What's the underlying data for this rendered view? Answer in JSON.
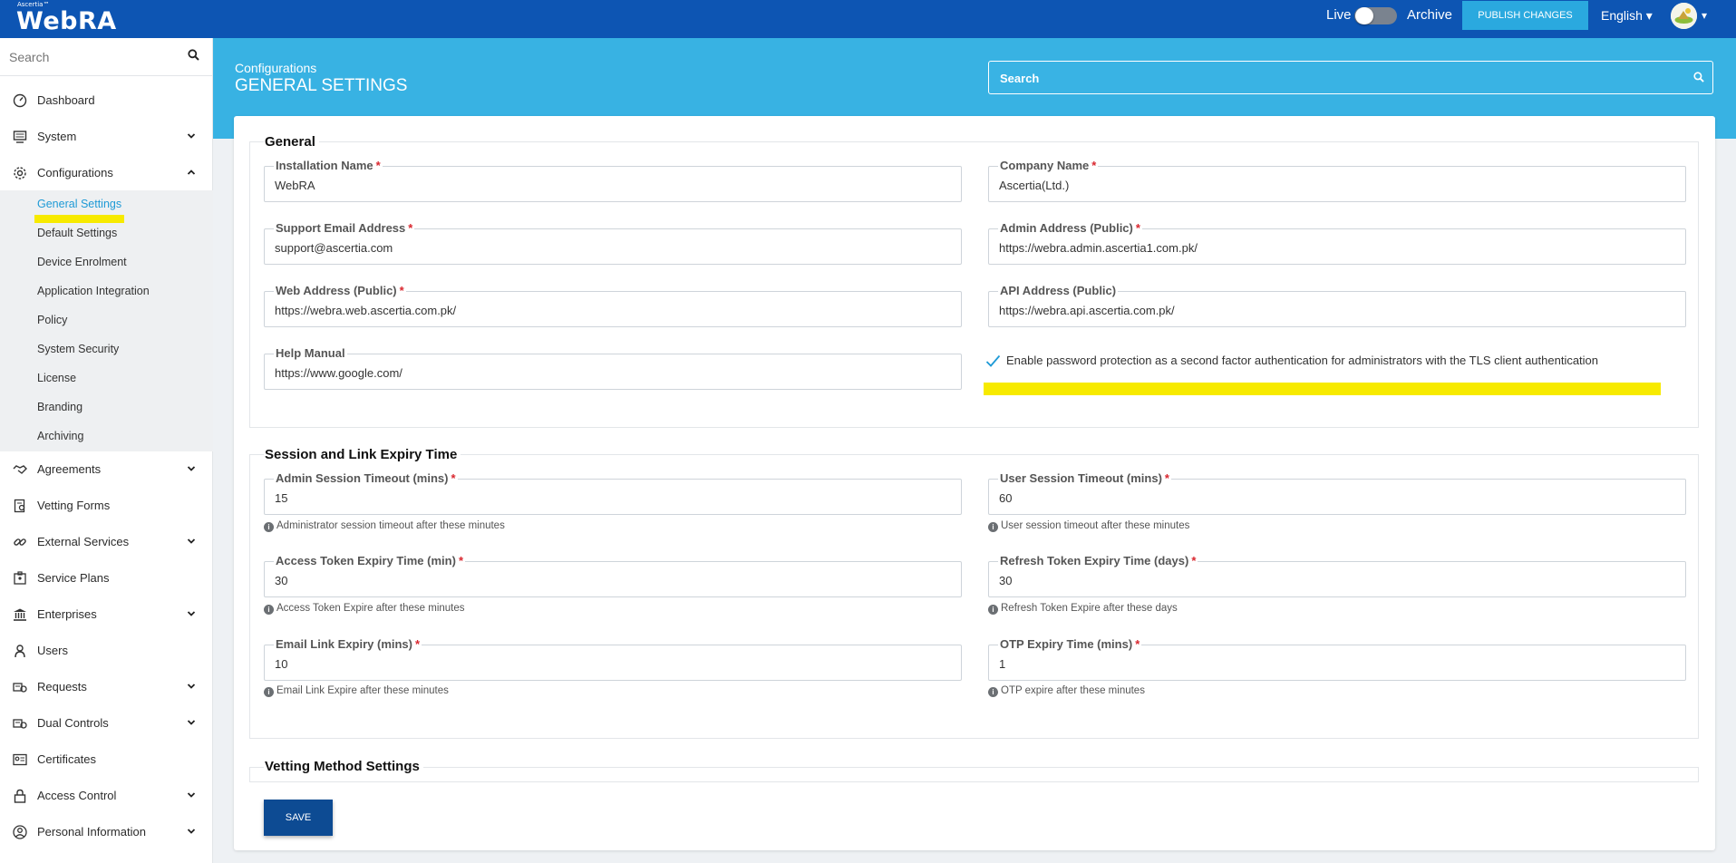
{
  "topbar": {
    "brand_small": "Ascertia™",
    "brand": "WebRA",
    "live_label": "Live",
    "archive_label": "Archive",
    "publish_label": "PUBLISH CHANGES",
    "language": "English ▾",
    "avatar_caret": "▾"
  },
  "sidebar": {
    "search_placeholder": "Search",
    "items": [
      {
        "label": "Dashboard",
        "icon": "dashboard-icon"
      },
      {
        "label": "System",
        "icon": "monitor-icon",
        "expanded": false
      },
      {
        "label": "Configurations",
        "icon": "gear-icon",
        "expanded": true
      },
      {
        "label": "Agreements",
        "icon": "handshake-icon",
        "expanded": false
      },
      {
        "label": "Vetting Forms",
        "icon": "form-icon"
      },
      {
        "label": "External Services",
        "icon": "link-icon",
        "expanded": false
      },
      {
        "label": "Service Plans",
        "icon": "plans-icon"
      },
      {
        "label": "Enterprises",
        "icon": "bank-icon",
        "expanded": false
      },
      {
        "label": "Users",
        "icon": "user-icon"
      },
      {
        "label": "Requests",
        "icon": "requests-icon",
        "expanded": false
      },
      {
        "label": "Dual Controls",
        "icon": "dual-controls-icon",
        "expanded": false
      },
      {
        "label": "Certificates",
        "icon": "certificate-icon"
      },
      {
        "label": "Access Control",
        "icon": "lock-icon",
        "expanded": false
      },
      {
        "label": "Personal Information",
        "icon": "person-icon",
        "expanded": false
      }
    ],
    "sub_items": [
      "General Settings",
      "Default Settings",
      "Device Enrolment",
      "Application Integration",
      "Policy",
      "System Security",
      "License",
      "Branding",
      "Archiving"
    ],
    "active_sub": "General Settings"
  },
  "header": {
    "breadcrumb": "Configurations",
    "title": "GENERAL SETTINGS",
    "search_placeholder": "Search"
  },
  "general": {
    "title": "General",
    "installation_name": {
      "label": "Installation Name",
      "value": "WebRA"
    },
    "company_name": {
      "label": "Company Name",
      "value": "Ascertia(Ltd.)"
    },
    "support_email": {
      "label": "Support Email Address",
      "value": "support@ascertia.com"
    },
    "admin_address": {
      "label": "Admin Address (Public)",
      "value": "https://webra.admin.ascertia1.com.pk/"
    },
    "web_address": {
      "label": "Web Address (Public)",
      "value": "https://webra.web.ascertia.com.pk/"
    },
    "api_address": {
      "label": "API Address (Public)",
      "value": "https://webra.api.ascertia.com.pk/"
    },
    "help_manual": {
      "label": "Help Manual",
      "value": "https://www.google.com/"
    },
    "tls_checkbox": {
      "label": "Enable password protection as a second factor authentication for administrators with the TLS client authentication",
      "checked": true
    }
  },
  "session": {
    "title": "Session and Link Expiry Time",
    "admin_timeout": {
      "label": "Admin Session Timeout (mins)",
      "value": "15",
      "help": "Administrator session timeout after these minutes"
    },
    "user_timeout": {
      "label": "User Session Timeout (mins)",
      "value": "60",
      "help": "User session timeout after these minutes"
    },
    "access_token": {
      "label": "Access Token Expiry Time (min)",
      "value": "30",
      "help": "Access Token Expire after these minutes"
    },
    "refresh_token": {
      "label": "Refresh Token Expiry Time (days)",
      "value": "30",
      "help": "Refresh Token Expire after these days"
    },
    "email_link": {
      "label": "Email Link Expiry (mins)",
      "value": "10",
      "help": "Email Link Expire after these minutes"
    },
    "otp_expiry": {
      "label": "OTP Expiry Time (mins)",
      "value": "1",
      "help": "OTP expire after these minutes"
    }
  },
  "vetting": {
    "title": "Vetting Method Settings"
  },
  "actions": {
    "save_label": "SAVE"
  },
  "colors": {
    "topbar": "#0d55b3",
    "header": "#38b2e3",
    "publish": "#2aa9df",
    "save": "#0d4b93",
    "highlight": "#f7ea00",
    "required": "#d9262e",
    "active_link": "#1e9ad6"
  }
}
